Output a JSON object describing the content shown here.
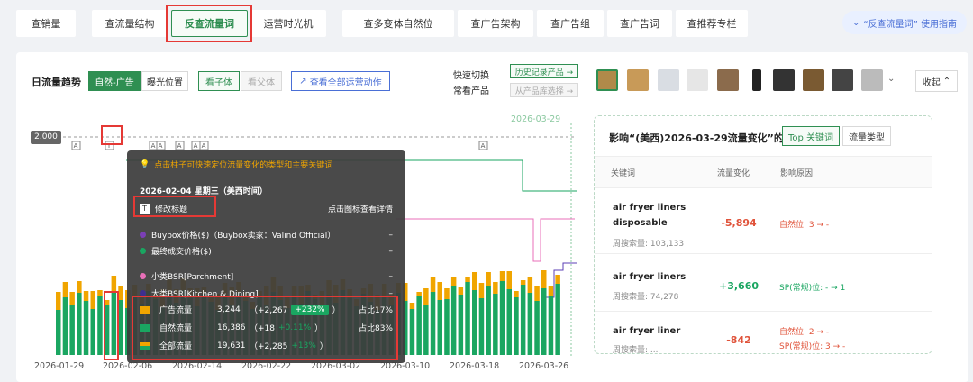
{
  "tabs": [
    {
      "label": "查销量",
      "active": false
    },
    {
      "label": "查流量结构",
      "active": false
    },
    {
      "label": "反查流量词",
      "active": true
    },
    {
      "label": "运营时光机",
      "active": false
    },
    {
      "label": "查多变体自然位",
      "active": false
    },
    {
      "label": "查广告架构",
      "active": false
    },
    {
      "label": "查广告组",
      "active": false
    },
    {
      "label": "查广告词",
      "active": false
    },
    {
      "label": "查推荐专栏",
      "active": false
    }
  ],
  "guide_link": "“反查流量词” 使用指南",
  "toolbar": {
    "title": "日流量趋势",
    "mode_natural_ad": "自然-广告",
    "mode_exposure": "曝光位置",
    "child": "看子体",
    "parent": "看父体",
    "view_all": "查看全部运营动作",
    "quick_switch": "快速切换",
    "common_products": "常看产品",
    "history": "历史记录产品 →",
    "product_select": "从产品库选择 →",
    "collapse": "收起"
  },
  "chart": {
    "ymark": "2.000",
    "date_flag": "2026-03-29",
    "x_ticks": [
      "2026-01-29",
      "2026-02-06",
      "2026-02-14",
      "2026-02-22",
      "2026-03-02",
      "2026-03-10",
      "2026-03-18",
      "2026-03-26"
    ],
    "marker_A": "A",
    "marker_T": "T"
  },
  "chart_data": {
    "type": "bar",
    "note": "stacked bars: green 自然流量, orange 广告流量",
    "series": [
      {
        "name": "自然流量",
        "color": "#1aa661"
      },
      {
        "name": "广告流量",
        "color": "#f0a500"
      }
    ]
  },
  "tooltip": {
    "hint": "点击柱子可快速定位流量变化的类型和主要关键词",
    "date": "2026-02-04  星期三（美西时间）",
    "edit_title": "修改标题",
    "click_icon": "点击图标查看详情",
    "buybox": "Buybox价格($)（Buybox卖家：Valind Official）",
    "final_price": "最终成交价格($)",
    "small_bsr": "小类BSR[Parchment]",
    "big_bsr": "大类BSR[Kitchen & Dining]",
    "dash": "–",
    "rows": [
      {
        "name": "广告流量",
        "value": "3,244",
        "change": "（+2,267",
        "pct": "+232%",
        "close": "）",
        "share": "占比17%",
        "color": "#f0a500"
      },
      {
        "name": "自然流量",
        "value": "16,386",
        "change": "（+18",
        "pct": "+0.11%",
        "close": "）",
        "share": "占比83%",
        "color": "#1aa661"
      },
      {
        "name": "全部流量",
        "value": "19,631",
        "change": "（+2,285",
        "pct": "+13%",
        "close": "）",
        "share": "",
        "color": "linear"
      }
    ]
  },
  "panel": {
    "title": "影响“(美西)2026-03-29流量变化”的",
    "btn_top": "Top 关键词",
    "btn_type": "流量类型",
    "col_kw": "关键词",
    "col_change": "流量变化",
    "col_reason": "影响原因",
    "rows": [
      {
        "kw1": "air fryer liners",
        "kw2": "disposable",
        "vol": "周搜索量: 103,133",
        "change": "-5,894",
        "reason": "自然位: 3 → -",
        "reason2": "",
        "color": "#e0533a",
        "rcolor": "#e0533a"
      },
      {
        "kw1": "air fryer liners",
        "kw2": "",
        "vol": "周搜索量: 74,278",
        "change": "+3,660",
        "reason": "SP(常规)位: - → 1",
        "reason2": "",
        "color": "#1aa661",
        "rcolor": "#1aa661"
      },
      {
        "kw1": "air fryer liner",
        "kw2": "",
        "vol": "周搜索量: ...",
        "change": "-842",
        "reason": "自然位: 2 → -",
        "reason2": "SP(常规)位: 3 → -",
        "color": "#e0533a",
        "rcolor": "#e0533a"
      }
    ]
  }
}
